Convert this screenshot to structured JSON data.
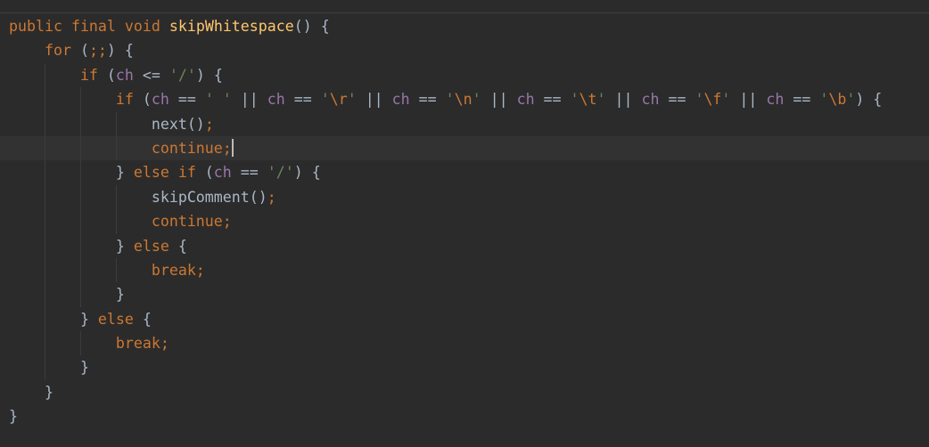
{
  "editor": {
    "language": "java",
    "caret_line": 6,
    "lines": [
      {
        "indent": 0,
        "tokens": [
          [
            "kw",
            "public"
          ],
          [
            "txt",
            " "
          ],
          [
            "kw",
            "final"
          ],
          [
            "txt",
            " "
          ],
          [
            "kw",
            "void"
          ],
          [
            "txt",
            " "
          ],
          [
            "fn",
            "skipWhitespace"
          ],
          [
            "txt",
            "() {"
          ]
        ]
      },
      {
        "indent": 1,
        "tokens": [
          [
            "kw",
            "for"
          ],
          [
            "txt",
            " ("
          ],
          [
            "kw",
            ";;"
          ],
          [
            "txt",
            ") {"
          ]
        ]
      },
      {
        "indent": 2,
        "tokens": [
          [
            "kw",
            "if"
          ],
          [
            "txt",
            " ("
          ],
          [
            "var",
            "ch"
          ],
          [
            "txt",
            " <= "
          ],
          [
            "str",
            "'/'"
          ],
          [
            "txt",
            ") {"
          ]
        ]
      },
      {
        "indent": 3,
        "tokens": [
          [
            "kw",
            "if"
          ],
          [
            "txt",
            " ("
          ],
          [
            "var",
            "ch"
          ],
          [
            "txt",
            " == "
          ],
          [
            "str",
            "' '"
          ],
          [
            "txt",
            " || "
          ],
          [
            "var",
            "ch"
          ],
          [
            "txt",
            " == "
          ],
          [
            "str",
            "'"
          ],
          [
            "esc",
            "\\r"
          ],
          [
            "str",
            "'"
          ],
          [
            "txt",
            " || "
          ],
          [
            "var",
            "ch"
          ],
          [
            "txt",
            " == "
          ],
          [
            "str",
            "'"
          ],
          [
            "esc",
            "\\n"
          ],
          [
            "str",
            "'"
          ],
          [
            "txt",
            " || "
          ],
          [
            "var",
            "ch"
          ],
          [
            "txt",
            " == "
          ],
          [
            "str",
            "'"
          ],
          [
            "esc",
            "\\t"
          ],
          [
            "str",
            "'"
          ],
          [
            "txt",
            " || "
          ],
          [
            "var",
            "ch"
          ],
          [
            "txt",
            " == "
          ],
          [
            "str",
            "'"
          ],
          [
            "esc",
            "\\f"
          ],
          [
            "str",
            "'"
          ],
          [
            "txt",
            " || "
          ],
          [
            "var",
            "ch"
          ],
          [
            "txt",
            " == "
          ],
          [
            "str",
            "'"
          ],
          [
            "esc",
            "\\b"
          ],
          [
            "str",
            "'"
          ],
          [
            "txt",
            ") {"
          ]
        ]
      },
      {
        "indent": 4,
        "tokens": [
          [
            "txt",
            "next()"
          ],
          [
            "kw",
            ";"
          ]
        ]
      },
      {
        "indent": 4,
        "tokens": [
          [
            "kw",
            "continue;"
          ]
        ]
      },
      {
        "indent": 3,
        "tokens": [
          [
            "txt",
            "} "
          ],
          [
            "kw",
            "else if"
          ],
          [
            "txt",
            " ("
          ],
          [
            "var",
            "ch"
          ],
          [
            "txt",
            " == "
          ],
          [
            "str",
            "'/'"
          ],
          [
            "txt",
            ") {"
          ]
        ]
      },
      {
        "indent": 4,
        "tokens": [
          [
            "txt",
            "skipComment()"
          ],
          [
            "kw",
            ";"
          ]
        ]
      },
      {
        "indent": 4,
        "tokens": [
          [
            "kw",
            "continue;"
          ]
        ]
      },
      {
        "indent": 3,
        "tokens": [
          [
            "txt",
            "} "
          ],
          [
            "kw",
            "else"
          ],
          [
            "txt",
            " {"
          ]
        ]
      },
      {
        "indent": 4,
        "tokens": [
          [
            "kw",
            "break;"
          ]
        ]
      },
      {
        "indent": 3,
        "tokens": [
          [
            "txt",
            "}"
          ]
        ]
      },
      {
        "indent": 2,
        "tokens": [
          [
            "txt",
            "} "
          ],
          [
            "kw",
            "else"
          ],
          [
            "txt",
            " {"
          ]
        ]
      },
      {
        "indent": 3,
        "tokens": [
          [
            "kw",
            "break;"
          ]
        ]
      },
      {
        "indent": 2,
        "tokens": [
          [
            "txt",
            "}"
          ]
        ]
      },
      {
        "indent": 1,
        "tokens": [
          [
            "txt",
            "}"
          ]
        ]
      },
      {
        "indent": 0,
        "tokens": [
          [
            "txt",
            "}"
          ]
        ]
      }
    ]
  },
  "colors": {
    "background": "#2b2b2b",
    "keyword": "#cc7832",
    "function": "#ffc66d",
    "field": "#9876aa",
    "string": "#6a8759",
    "text": "#a9b7c6",
    "current_line": "#323232"
  }
}
